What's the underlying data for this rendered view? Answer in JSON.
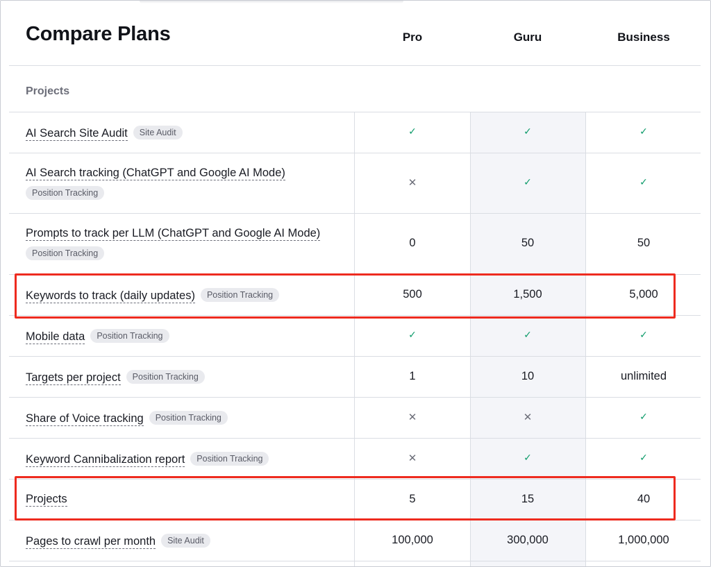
{
  "title": "Compare Plans",
  "plans": [
    "Pro",
    "Guru",
    "Business"
  ],
  "section": "Projects",
  "rows": [
    {
      "feature": "AI Search Site Audit",
      "badge": "Site Audit",
      "badge_block": false,
      "pro": "✓",
      "guru": "✓",
      "business": "✓",
      "kinds": [
        "check",
        "check",
        "check"
      ]
    },
    {
      "feature": "AI Search tracking (ChatGPT and Google AI Mode)",
      "badge": "Position Tracking",
      "badge_block": true,
      "pro": "✕",
      "guru": "✓",
      "business": "✓",
      "kinds": [
        "cross",
        "check",
        "check"
      ]
    },
    {
      "feature": "Prompts to track per LLM (ChatGPT and Google AI Mode)",
      "badge": "Position Tracking",
      "badge_block": true,
      "pro": "0",
      "guru": "50",
      "business": "50",
      "kinds": [
        "text",
        "text",
        "text"
      ]
    },
    {
      "feature": "Keywords to track (daily updates)",
      "badge": "Position Tracking",
      "badge_block": false,
      "pro": "500",
      "guru": "1,500",
      "business": "5,000",
      "kinds": [
        "text",
        "text",
        "text"
      ]
    },
    {
      "feature": "Mobile data",
      "badge": "Position Tracking",
      "badge_block": false,
      "pro": "✓",
      "guru": "✓",
      "business": "✓",
      "kinds": [
        "check",
        "check",
        "check"
      ]
    },
    {
      "feature": "Targets per project",
      "badge": "Position Tracking",
      "badge_block": false,
      "pro": "1",
      "guru": "10",
      "business": "unlimited",
      "kinds": [
        "text",
        "text",
        "text"
      ]
    },
    {
      "feature": "Share of Voice tracking",
      "badge": "Position Tracking",
      "badge_block": false,
      "pro": "✕",
      "guru": "✕",
      "business": "✓",
      "kinds": [
        "cross",
        "cross",
        "check"
      ]
    },
    {
      "feature": "Keyword Cannibalization report",
      "badge": "Position Tracking",
      "badge_block": false,
      "pro": "✕",
      "guru": "✓",
      "business": "✓",
      "kinds": [
        "cross",
        "check",
        "check"
      ]
    },
    {
      "feature": "Projects",
      "badge": "",
      "badge_block": false,
      "pro": "5",
      "guru": "15",
      "business": "40",
      "kinds": [
        "text",
        "text",
        "text"
      ]
    },
    {
      "feature": "Pages to crawl per month",
      "badge": "Site Audit",
      "badge_block": false,
      "pro": "100,000",
      "guru": "300,000",
      "business": "1,000,000",
      "kinds": [
        "text",
        "text",
        "text"
      ]
    }
  ],
  "colors": {
    "check": "#0d9b6a",
    "highlight": "#ee2b1f",
    "guru_column": "#f4f5f9"
  },
  "icons": {
    "check": "check-icon",
    "cross": "cross-icon"
  }
}
